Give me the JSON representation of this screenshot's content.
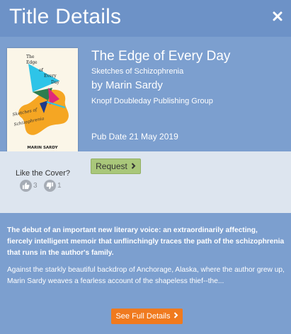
{
  "header": {
    "title": "Title Details",
    "close_icon": "close-icon"
  },
  "book": {
    "title": "The Edge of Every Day",
    "subtitle": "Sketches of Schizophrenia",
    "author_line": "by Marin Sardy",
    "publisher": "Knopf Doubleday Publishing Group",
    "pub_date": "Pub Date 21 May 2019",
    "cover": {
      "title_lines": [
        "The",
        "Edge",
        "of",
        "Every",
        "Day"
      ],
      "subtitle_script": "Sketches of Schizophrenia",
      "author": "MARIN SARDY",
      "colors": {
        "background": "#fbf6e8",
        "blob": "#f5a623",
        "cyan": "#2ec4e8",
        "green": "#2e7d4f",
        "magenta": "#e0287a",
        "navy": "#1e3a8a"
      }
    }
  },
  "actions": {
    "like_prompt": "Like the Cover?",
    "thumbs_up_count": "3",
    "thumbs_down_count": "1",
    "request_label": "Request"
  },
  "description": {
    "bold": "The debut of an important new literary voice: an extraordinarily affecting, fiercely intelligent memoir that unflinchingly traces the path of the schizophrenia that runs in the author's family.",
    "body": "Against the starkly beautiful backdrop of Anchorage, Alaska, where the author grew up, Marin Sardy weaves a fearless account of the shapeless thief--the..."
  },
  "footer": {
    "full_details_label": "See Full Details"
  },
  "colors": {
    "header_bg": "#6d92c7",
    "panel_bg": "#7c9fcf",
    "actions_bg": "#dde5ef",
    "request_btn": "#a9c77a",
    "full_details_btn": "#f07a1e"
  }
}
